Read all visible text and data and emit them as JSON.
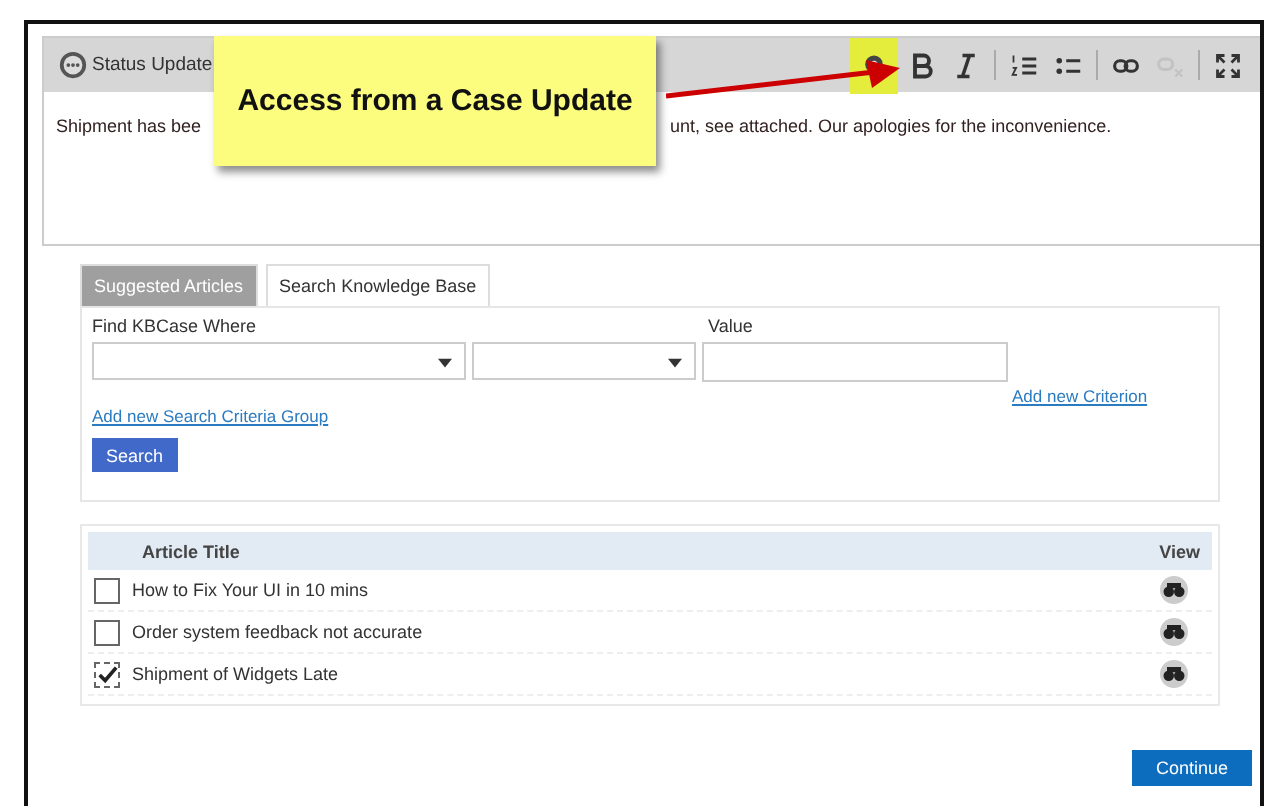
{
  "editor": {
    "title": "Status Update",
    "toolbar": [
      {
        "kind": "knowledge",
        "selected": true
      },
      {
        "kind": "bold",
        "selected": false
      },
      {
        "kind": "italic",
        "selected": false
      },
      {
        "kind": "numbered",
        "selected": false
      },
      {
        "kind": "bullets",
        "selected": false
      },
      {
        "kind": "link",
        "selected": false
      },
      {
        "kind": "unlink",
        "selected": false,
        "disabled": true
      },
      {
        "kind": "maximize",
        "selected": false
      }
    ],
    "text_start": "Shipment has bee",
    "text_end": "unt, see attached. Our apologies for the inconvenience."
  },
  "callout": {
    "text": "Access from a Case Update"
  },
  "tabs": [
    {
      "label": "Suggested Articles",
      "selected": false
    },
    {
      "label": "Search Knowledge Base",
      "selected": true
    }
  ],
  "search": {
    "find_label": "Find KBCase Where",
    "value_label": "Value",
    "add_criterion": "Add new Criterion",
    "add_group": "Add new Search Criteria Group",
    "button": "Search"
  },
  "table": {
    "columns": [
      "Article Title",
      "View"
    ],
    "rows": [
      {
        "title": "How to Fix Your UI in 10 mins",
        "checked": false
      },
      {
        "title": "Order system feedback not accurate",
        "checked": false
      },
      {
        "title": "Shipment of Widgets Late",
        "checked": true
      }
    ]
  },
  "continue_button": "Continue"
}
